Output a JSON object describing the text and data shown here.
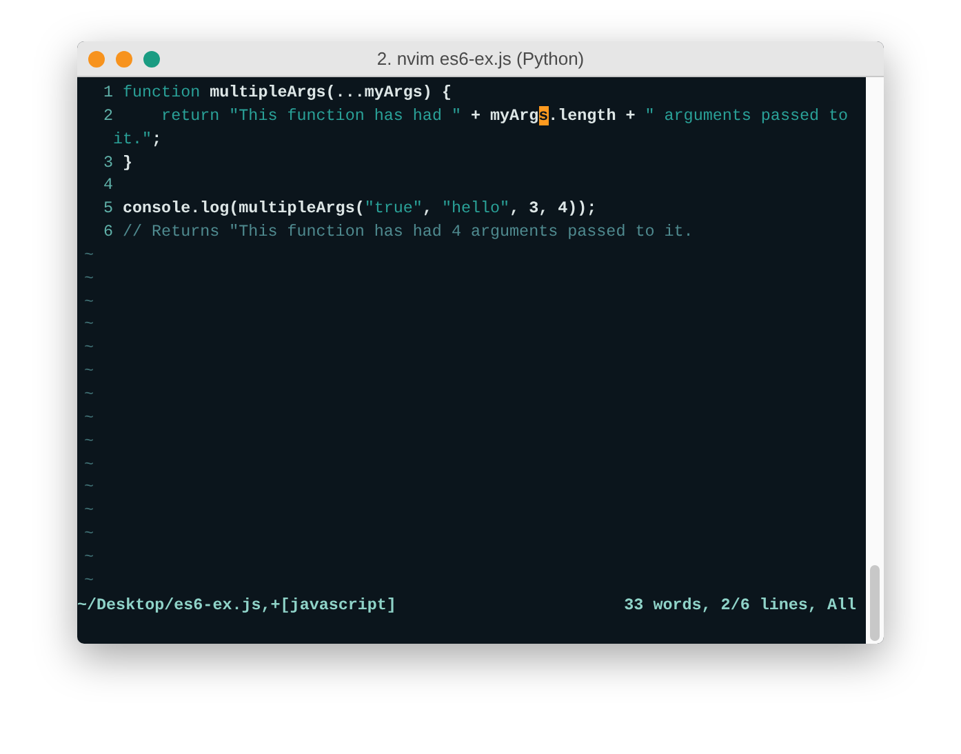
{
  "window": {
    "title": "2. nvim es6-ex.js (Python)"
  },
  "editor": {
    "rows": [
      {
        "number": "1",
        "segments": [
          {
            "kind": "keyword",
            "text": "function "
          },
          {
            "kind": "ident",
            "text": "multipleArgs(...myArgs) {"
          }
        ]
      },
      {
        "number": "2",
        "segments": [
          {
            "kind": "keyword",
            "text": "    return "
          },
          {
            "kind": "string",
            "text": "\"This function has had \""
          },
          {
            "kind": "ident",
            "text": " + myArg"
          },
          {
            "kind": "cursor",
            "text": "s"
          },
          {
            "kind": "ident",
            "text": ".length + "
          },
          {
            "kind": "string",
            "text": "\" arguments passed to"
          }
        ]
      },
      {
        "segments": [
          {
            "kind": "string",
            "text": "it.\""
          },
          {
            "kind": "ident",
            "text": ";"
          }
        ]
      },
      {
        "number": "3",
        "segments": [
          {
            "kind": "ident",
            "text": "}"
          }
        ]
      },
      {
        "number": "4",
        "segments": []
      },
      {
        "number": "5",
        "segments": [
          {
            "kind": "ident",
            "text": "console.log(multipleArgs("
          },
          {
            "kind": "string",
            "text": "\"true\""
          },
          {
            "kind": "ident",
            "text": ", "
          },
          {
            "kind": "string",
            "text": "\"hello\""
          },
          {
            "kind": "ident",
            "text": ", 3, 4));"
          }
        ]
      },
      {
        "number": "6",
        "segments": [
          {
            "kind": "comment",
            "text": "// Returns \"This function has had 4 arguments passed to it."
          }
        ]
      }
    ],
    "filler": [
      "~",
      "~",
      "~",
      "~",
      "~",
      "~",
      "~",
      "~",
      "~",
      "~",
      "~",
      "~",
      "~",
      "~",
      "~"
    ]
  },
  "status_bar": {
    "file": "~/Desktop/es6-ex.js,+[javascript]",
    "info": "33 words, 2/6 lines, All"
  }
}
